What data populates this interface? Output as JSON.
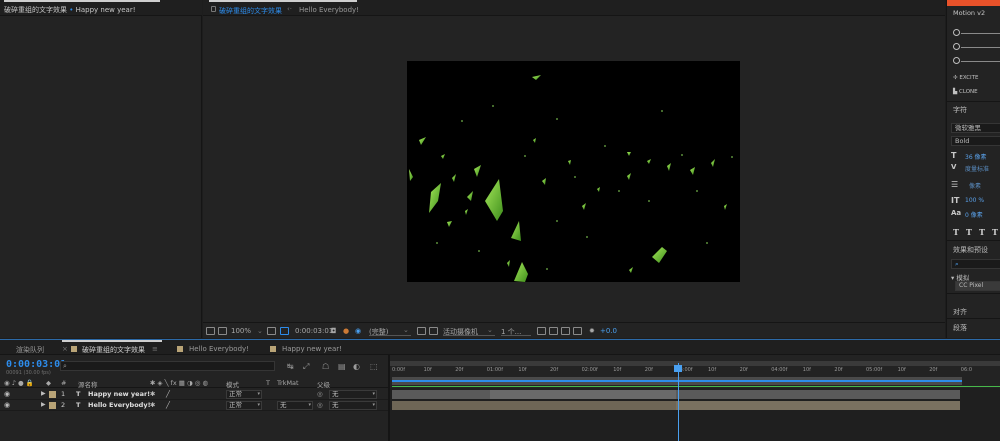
{
  "project_tab": {
    "label": "破碎重组的文字效果",
    "bullet": "•",
    "sub": "Happy new year!"
  },
  "viewer_tabs": {
    "comp": "破碎重组的文字效果",
    "arrow": "‹·",
    "other": "Hello Everybody!"
  },
  "viewer_toolbar": {
    "zoom": "100%",
    "timecode": "0:00:03:01",
    "resolution": "(完整)",
    "camera": "活动摄像机",
    "view": "1 个...",
    "exposure": "+0.0"
  },
  "right_panel": {
    "motion_title": "Motion v2",
    "excite": "EXCITE",
    "clone": "CLONE",
    "character_title": "字符",
    "font_family": "微软雅黑",
    "font_style": "Bold",
    "font_size": "36 像素",
    "kerning": "度量标准",
    "leading": "像素",
    "scale": "100 %",
    "baseline": "0 像素",
    "effects_title": "效果和预设",
    "search_placeholder": "⌕",
    "tree_item": "▾ 模拟",
    "effect_item": "CC Pixel",
    "align_title": "对齐",
    "paragraph_title": "段落"
  },
  "timeline": {
    "render_queue_tab": "渲染队列",
    "comp_tab": "破碎重组的文字效果",
    "hello_tab": "Hello Everybody!",
    "happy_tab": "Happy new year!",
    "timecode": "0:00:03:01",
    "timecode_sub": "00091 (30.00 fps)",
    "headers": {
      "hash": "#",
      "source_name": "源名称",
      "mode": "模式",
      "t": "T",
      "trkmat": "TrkMat",
      "parent": "父级"
    },
    "layers": [
      {
        "num": "1",
        "type": "T",
        "name": "Happy new year!",
        "mode": "正常",
        "trkmat": "",
        "parent": "无"
      },
      {
        "num": "2",
        "type": "T",
        "name": "Hello Everybody!",
        "mode": "正常",
        "trkmat": "无",
        "parent": "无"
      }
    ],
    "ruler": [
      "0:00f",
      "10f",
      "20f",
      "01:00f",
      "10f",
      "20f",
      "02:00f",
      "10f",
      "20f",
      "03:00f",
      "10f",
      "20f",
      "04:00f",
      "10f",
      "20f",
      "05:00f",
      "10f",
      "20f",
      "06:0"
    ]
  },
  "colors": {
    "accent_blue": "#2d8ceb",
    "label_tan": "#b9a477",
    "motion_orange": "#e8522a",
    "shard_green": "#6fc43a"
  }
}
